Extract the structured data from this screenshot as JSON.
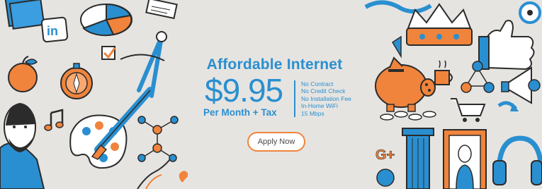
{
  "banner": {
    "headline": "Affordable Internet",
    "price": "$9.95",
    "price_subline": "Per Month + Tax",
    "features": [
      "No Contract",
      "No Credit Check",
      "No Installation Fee",
      "In-Home WiFi",
      "15 Mbps"
    ],
    "cta_label": "Apply Now",
    "social_labels": {
      "linkedin": "in",
      "google_plus": "G+"
    }
  },
  "colors": {
    "background": "#e6e4e1",
    "brand_blue": "#2a8fd0",
    "accent_orange": "#f0843c",
    "ink": "#2b2b2b"
  },
  "illustrations": {
    "left": [
      "folder-icon",
      "linkedin-icon",
      "pie-chart-icon",
      "paper-icon",
      "apple-icon",
      "compass-icon",
      "checkbox-icon",
      "drafting-compass-icon",
      "music-note-icon",
      "lincoln-portrait",
      "paint-palette-icon",
      "paintbrush-icon",
      "molecule-icon",
      "dna-icon",
      "heart-icon"
    ],
    "right": [
      "crown-icon",
      "thumbs-up-icon",
      "piggy-bank-icon",
      "coffee-cup-icon",
      "users-network-icon",
      "megaphone-icon",
      "coins-icon",
      "shopping-cart-icon",
      "google-plus-icon",
      "column-icon",
      "mona-lisa-frame",
      "headphones-icon"
    ]
  }
}
